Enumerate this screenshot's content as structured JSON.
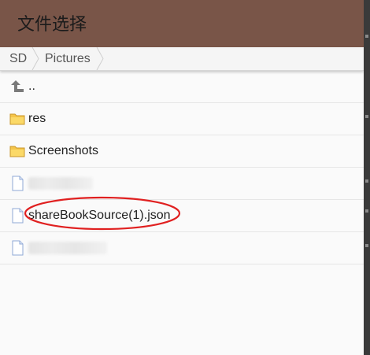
{
  "dialog": {
    "title": "文件选择"
  },
  "breadcrumb": {
    "items": [
      "SD",
      "Pictures"
    ]
  },
  "files": [
    {
      "name": "..",
      "type": "parent",
      "icon": "parent-folder-icon"
    },
    {
      "name": "res",
      "type": "folder",
      "icon": "folder-icon"
    },
    {
      "name": "Screenshots",
      "type": "folder",
      "icon": "folder-icon"
    },
    {
      "name": "",
      "type": "file",
      "icon": "file-icon",
      "obscured": true
    },
    {
      "name": "shareBookSource(1).json",
      "type": "file",
      "icon": "file-icon",
      "highlighted": true
    },
    {
      "name": "",
      "type": "file",
      "icon": "file-icon",
      "obscured": true
    }
  ],
  "colors": {
    "titlebar": "#795548",
    "annotation": "#e02020",
    "folder": "#f5c54a"
  }
}
